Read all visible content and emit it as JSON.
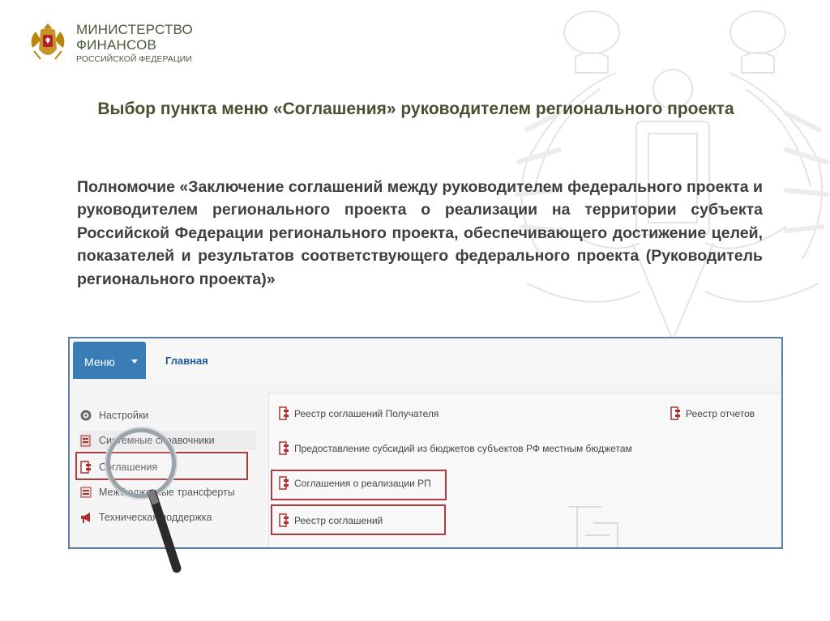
{
  "colors": {
    "title": "#4a4f32",
    "org": "#4a5a3a",
    "frame": "#5e7fa0",
    "menu": "#3a7db6",
    "highlight": "#b23a3a",
    "link": "#1e5a96"
  },
  "header": {
    "org_line1": "МИНИСТЕРСТВО",
    "org_line2": "ФИНАНСОВ",
    "org_line3": "РОССИЙСКОЙ ФЕДЕРАЦИИ"
  },
  "slide": {
    "title": "Выбор пункта меню «Соглашения» руководителем регионального проекта",
    "paragraph": "Полномочие «Заключение соглашений между руководителем федерального проекта и руководителем регионального проекта о реализации на территории субъекта Российской Федерации регионального проекта, обеспечивающего достижение целей, показателей и результатов соответствующего федерального проекта (Руководитель регионального проекта)»"
  },
  "app": {
    "menu_label": "Меню",
    "home_label": "Главная",
    "sidebar": [
      {
        "label": "Настройки",
        "icon": "gear-icon"
      },
      {
        "label": "Системные справочники",
        "icon": "book-icon"
      },
      {
        "label": "Соглашения",
        "icon": "document-icon"
      },
      {
        "label": "Межбюджетные трансферты",
        "icon": "transfer-icon"
      },
      {
        "label": "Техническая поддержка",
        "icon": "megaphone-icon"
      }
    ],
    "main_links": [
      {
        "label": "Реестр соглашений Получателя"
      },
      {
        "label": "Реестр отчетов"
      },
      {
        "label": "Предоставление субсидий из бюджетов субъектов РФ местным бюджетам"
      },
      {
        "label": "Соглашения о реализации РП"
      },
      {
        "label": "Реестр соглашений"
      }
    ]
  }
}
